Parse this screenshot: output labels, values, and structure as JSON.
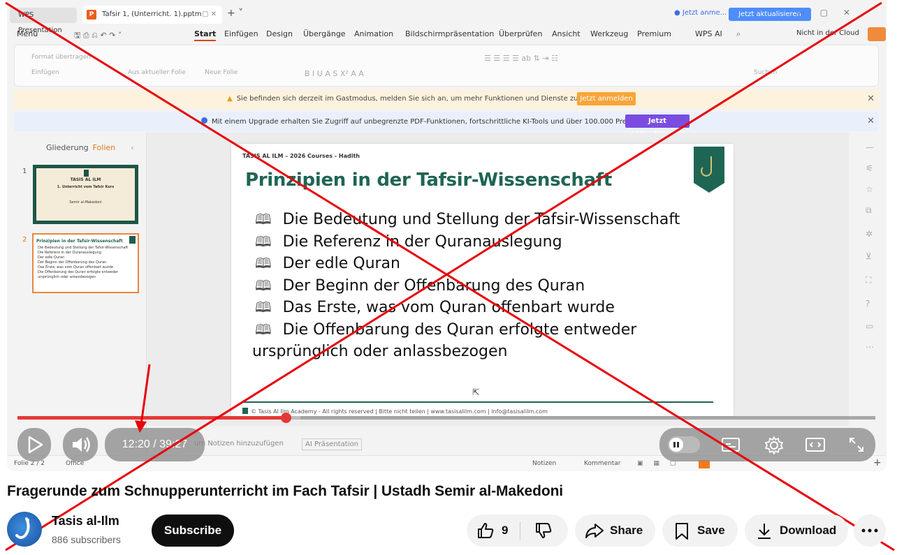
{
  "wps": {
    "tab_home": "WPS Presentation",
    "tab_doc": "Tafsir 1, (Unterricht. 1).pptm",
    "account": "Jetzt anme...",
    "update_button": "Jetzt aktualisieren",
    "menu": [
      "Menü",
      "Start",
      "Einfügen",
      "Design",
      "Übergänge",
      "Animation",
      "Bildschirmpräsentation",
      "Überprüfen",
      "Ansicht",
      "Werkzeug",
      "Premium",
      "WPS AI",
      "Nicht in der Cloud"
    ],
    "ribbon": {
      "format": "Format übertragen",
      "insert": "Einfügen",
      "from_current": "Aus aktueller Folie",
      "new_slide": "Neue Folie",
      "search": "Suchen"
    },
    "guest_msg": "Sie befinden sich derzeit im Gastmodus, melden Sie sich an, um mehr Funktionen und Dienste zu aktivieren.",
    "guest_button": "Jetzt anmelden",
    "upgrade_msg": "Mit einem Upgrade erhalten Sie Zugriff auf unbegrenzte PDF-Funktionen, fortschrittliche KI-Tools und über 100.000 Premium-Vorlagen.",
    "upgrade_button": "Jetzt aktualisieren",
    "panel_tabs": [
      "Gliederung",
      "Folien"
    ],
    "thumb1": {
      "num": "1",
      "brand": "TASIS AL ILM",
      "title": "1. Unterricht vom Tafsir Kurs",
      "subtitle": "Semir al-Makedoni"
    },
    "thumb2": {
      "num": "2",
      "title": "Prinzipien in der Tafsir-Wissenschaft",
      "lines": "Die Bedeutung und Stellung der Tafsir-Wissenschaft\nDie Referenz in der Quranauslegung\nDer edle Quran\nDer Beginn der Offenbarung des Quran\nDas Erste, was vom Quran offenbart wurde\nDie Offenbarung des Quran erfolgte entweder\nursprünglich oder anlassbezogen"
    },
    "slide": {
      "header": "TASIS AL ILM – 2026 Courses - Hadith",
      "title": "Prinzipien in der Tafsir-Wissenschaft",
      "logo_text": "TASIS AL ILM",
      "bullets": [
        "Die Bedeutung und Stellung der Tafsir-Wissenschaft",
        "Die Referenz in der Quranauslegung",
        "Der edle Quran",
        "Der Beginn der Offenbarung des Quran",
        "Das Erste, was vom Quran offenbart wurde",
        "Die Offenbarung des Quran erfolgte entweder"
      ],
      "continuation": "ursprünglich oder anlassbezogen",
      "footer": "© Tasis Al Ilm Academy - All rights reserved | Bitte nicht teilen | www.tasisalilm.com | info@tasisalilm.com"
    },
    "notes_hint": "um Notizen hinzuzufügen",
    "ai_presentation": "AI Präsentation",
    "status": {
      "slide": "Folie 2 / 2",
      "office": "Office",
      "notes": "Notizen",
      "comment": "Kommentar"
    }
  },
  "video": {
    "current_time": "12:20",
    "duration": "39:27",
    "time_display": "12:20 / 39:27",
    "progress_fraction": 0.313,
    "buffered_fraction": 0.33
  },
  "title": "Fragerunde zum Schnupperunterricht im Fach Tafsir | Ustadh Semir al-Makedoni",
  "channel": {
    "name": "Tasis al-Ilm",
    "subscribers": "886 subscribers"
  },
  "actions": {
    "subscribe": "Subscribe",
    "likes": "9",
    "share": "Share",
    "save": "Save",
    "download": "Download"
  },
  "colors": {
    "progress": "#e53935",
    "annotation": "#e8000a",
    "slide_title": "#1f6553"
  }
}
